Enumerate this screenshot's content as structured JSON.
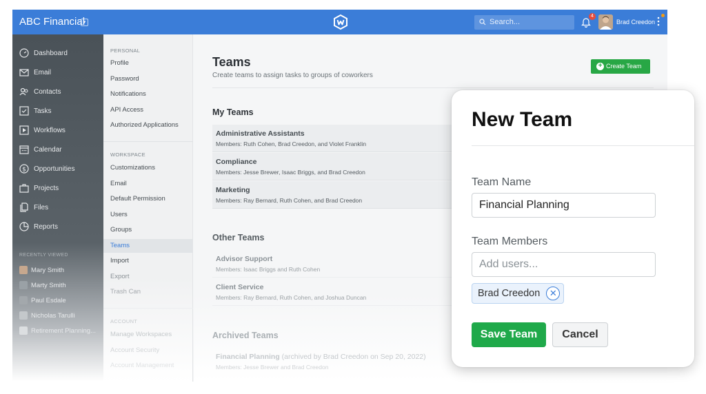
{
  "topbar": {
    "brand": "ABC Financial",
    "search_placeholder": "Search...",
    "notification_count": "4",
    "user_name": "Brad Creedon"
  },
  "sidebar": {
    "items": [
      {
        "label": "Dashboard",
        "icon": "dashboard-icon"
      },
      {
        "label": "Email",
        "icon": "email-icon"
      },
      {
        "label": "Contacts",
        "icon": "contacts-icon"
      },
      {
        "label": "Tasks",
        "icon": "tasks-icon"
      },
      {
        "label": "Workflows",
        "icon": "workflows-icon"
      },
      {
        "label": "Calendar",
        "icon": "calendar-icon"
      },
      {
        "label": "Opportunities",
        "icon": "opportunities-icon"
      },
      {
        "label": "Projects",
        "icon": "projects-icon"
      },
      {
        "label": "Files",
        "icon": "files-icon"
      },
      {
        "label": "Reports",
        "icon": "reports-icon"
      }
    ],
    "recent_header": "RECENTLY VIEWED",
    "recent": [
      "Mary Smith",
      "Marty Smith",
      "Paul Esdale",
      "Nicholas Tarulli",
      "Retirement Planning..."
    ]
  },
  "settings": {
    "personal_header": "PERSONAL",
    "personal": [
      "Profile",
      "Password",
      "Notifications",
      "API Access",
      "Authorized Applications"
    ],
    "workspace_header": "WORKSPACE",
    "workspace": [
      "Customizations",
      "Email",
      "Default Permission",
      "Users",
      "Groups",
      "Teams",
      "Import",
      "Export",
      "Trash Can"
    ],
    "account_header": "ACCOUNT",
    "account": [
      "Manage Workspaces",
      "Account Security",
      "Account Management"
    ]
  },
  "main": {
    "title": "Teams",
    "subtitle": "Create teams to assign tasks to groups of coworkers",
    "create_button": "Create Team",
    "my_teams_title": "My Teams",
    "my_teams": [
      {
        "name": "Administrative Assistants",
        "members": "Members: Ruth Cohen, Brad Creedon, and Violet Franklin"
      },
      {
        "name": "Compliance",
        "members": "Members: Jesse Brewer, Isaac Briggs, and Brad Creedon"
      },
      {
        "name": "Marketing",
        "members": "Members: Ray Bernard, Ruth Cohen, and Brad Creedon"
      }
    ],
    "other_teams_title": "Other Teams",
    "other_teams": [
      {
        "name": "Advisor Support",
        "members": "Members: Isaac Briggs and Ruth Cohen"
      },
      {
        "name": "Client Service",
        "members": "Members: Ray Bernard, Ruth Cohen, and Joshua Duncan"
      }
    ],
    "archived_title": "Archived Teams",
    "archived_teams": [
      {
        "name": "Financial Planning",
        "note": " (archived by Brad Creedon on Sep 20, 2022)",
        "members": "Members: Jesse Brewer and Brad Creedon"
      }
    ]
  },
  "modal": {
    "title": "New Team",
    "team_name_label": "Team Name",
    "team_name_value": "Financial Planning",
    "members_label": "Team Members",
    "members_placeholder": "Add users...",
    "selected_member": "Brad Creedon",
    "save_label": "Save Team",
    "cancel_label": "Cancel"
  },
  "colors": {
    "topbar": "#3b7dd8",
    "sidebar": "#4a5258",
    "create_button": "#28a745",
    "save_button": "#1fa94a",
    "active_link": "#3b7dd8"
  }
}
